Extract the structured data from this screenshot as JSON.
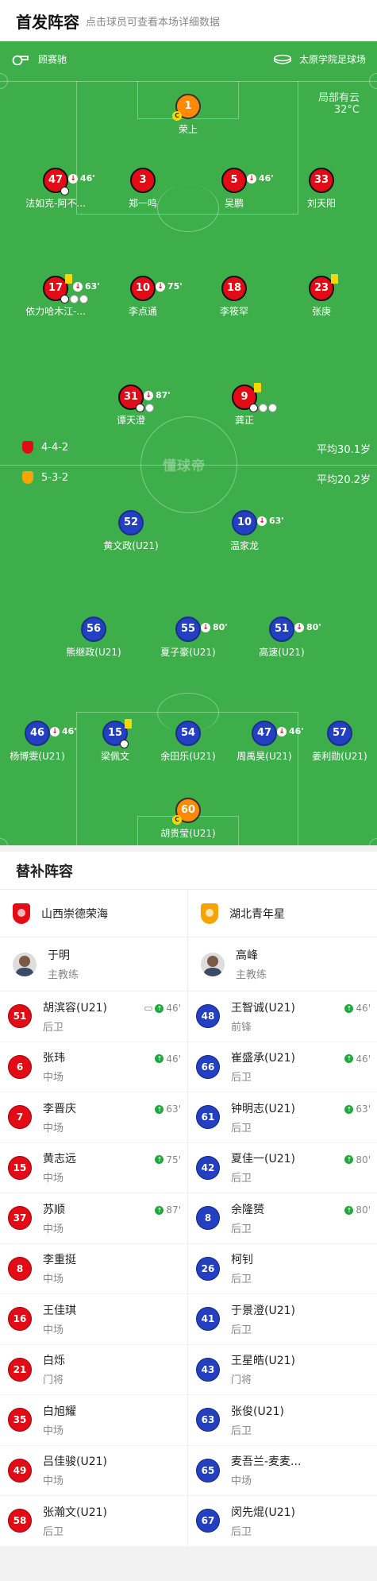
{
  "header": {
    "title": "首发阵容",
    "subtitle": "点击球员可查看本场详细数据"
  },
  "pitch": {
    "referee": "顾赛驰",
    "stadium": "太原学院足球场",
    "weather": "局部有云",
    "temperature": "32°C",
    "watermark": "懂球帝",
    "home": {
      "formation": "4-4-2",
      "avg_age": "平均30.1岁",
      "color": "#e20b16"
    },
    "away": {
      "formation": "5-3-2",
      "avg_age": "平均20.2岁",
      "color": "#f5a400"
    },
    "home_players": [
      {
        "num": "1",
        "name": "荣上",
        "gk": true,
        "captain": true
      },
      {
        "num": "47",
        "name": "法如克-阿不...",
        "sub": "46'",
        "balls": 1
      },
      {
        "num": "3",
        "name": "郑一鸣"
      },
      {
        "num": "5",
        "name": "吴鹏",
        "sub": "46'"
      },
      {
        "num": "33",
        "name": "刘天阳"
      },
      {
        "num": "17",
        "name": "依力哈木江-...",
        "sub": "63'",
        "yellow": true,
        "balls": 3
      },
      {
        "num": "10",
        "name": "李点通",
        "sub": "75'"
      },
      {
        "num": "18",
        "name": "李筱罕"
      },
      {
        "num": "23",
        "name": "张庚",
        "yellow": true
      },
      {
        "num": "31",
        "name": "谭天澄",
        "sub": "87'",
        "balls": 2
      },
      {
        "num": "9",
        "name": "龚正",
        "yellow": true,
        "balls": 3
      }
    ],
    "away_players": [
      {
        "num": "52",
        "name": "黄文政(U21)"
      },
      {
        "num": "10",
        "name": "温家龙",
        "sub": "63'"
      },
      {
        "num": "56",
        "name": "熊继政(U21)"
      },
      {
        "num": "55",
        "name": "夏子豪(U21)",
        "sub": "80'"
      },
      {
        "num": "51",
        "name": "高速(U21)",
        "sub": "80'"
      },
      {
        "num": "46",
        "name": "杨博雯(U21)",
        "sub": "46'"
      },
      {
        "num": "15",
        "name": "梁佩文",
        "yellow": true,
        "balls": 1
      },
      {
        "num": "54",
        "name": "余田乐(U21)"
      },
      {
        "num": "47",
        "name": "周禹昊(U21)",
        "sub": "46'"
      },
      {
        "num": "57",
        "name": "姜利勋(U21)"
      },
      {
        "num": "60",
        "name": "胡贵莹(U21)",
        "gk": true,
        "captain": true
      }
    ]
  },
  "subs": {
    "title": "替补阵容",
    "home": {
      "team": "山西崇德荣海",
      "coach": "于明",
      "coach_role": "主教练",
      "players": [
        {
          "num": "51",
          "name": "胡滨容(U21)",
          "pos": "后卫",
          "time": "46'",
          "whistle": true
        },
        {
          "num": "6",
          "name": "张玮",
          "pos": "中场",
          "time": "46'"
        },
        {
          "num": "7",
          "name": "李晋庆",
          "pos": "中场",
          "time": "63'"
        },
        {
          "num": "15",
          "name": "黄志远",
          "pos": "中场",
          "time": "75'"
        },
        {
          "num": "37",
          "name": "苏顺",
          "pos": "中场",
          "time": "87'"
        },
        {
          "num": "8",
          "name": "李重挺",
          "pos": "中场"
        },
        {
          "num": "16",
          "name": "王佳琪",
          "pos": "中场"
        },
        {
          "num": "21",
          "name": "白烁",
          "pos": "门将"
        },
        {
          "num": "35",
          "name": "白旭耀",
          "pos": "中场"
        },
        {
          "num": "49",
          "name": "吕佳骏(U21)",
          "pos": "中场"
        },
        {
          "num": "58",
          "name": "张瀚文(U21)",
          "pos": "后卫"
        }
      ]
    },
    "away": {
      "team": "湖北青年星",
      "coach": "高峰",
      "coach_role": "主教练",
      "players": [
        {
          "num": "48",
          "name": "王智诚(U21)",
          "pos": "前锋",
          "time": "46'"
        },
        {
          "num": "66",
          "name": "崔盛承(U21)",
          "pos": "后卫",
          "time": "46'"
        },
        {
          "num": "61",
          "name": "钟明志(U21)",
          "pos": "后卫",
          "time": "63'"
        },
        {
          "num": "42",
          "name": "夏佳一(U21)",
          "pos": "后卫",
          "time": "80'"
        },
        {
          "num": "8",
          "name": "余隆赟",
          "pos": "后卫",
          "time": "80'"
        },
        {
          "num": "26",
          "name": "柯钊",
          "pos": "后卫"
        },
        {
          "num": "41",
          "name": "于景澄(U21)",
          "pos": "后卫"
        },
        {
          "num": "43",
          "name": "王星皓(U21)",
          "pos": "门将"
        },
        {
          "num": "63",
          "name": "张俊(U21)",
          "pos": "后卫"
        },
        {
          "num": "65",
          "name": "麦吾兰-麦麦...",
          "pos": "中场"
        },
        {
          "num": "67",
          "name": "闵先焜(U21)",
          "pos": "后卫"
        }
      ]
    }
  }
}
